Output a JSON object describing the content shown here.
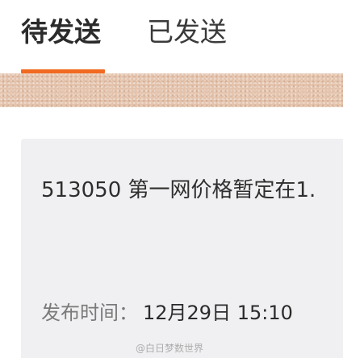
{
  "tabs": {
    "pending_label": "待发送",
    "sent_label": "已发送",
    "active": "pending",
    "accent_color": "#f26a21"
  },
  "message": {
    "content": "513050 第一网价格暂定在1.",
    "time_label": "发布时间：",
    "time_value": "12月29日 15:10"
  },
  "watermark": {
    "text": "@白日梦数世界"
  }
}
